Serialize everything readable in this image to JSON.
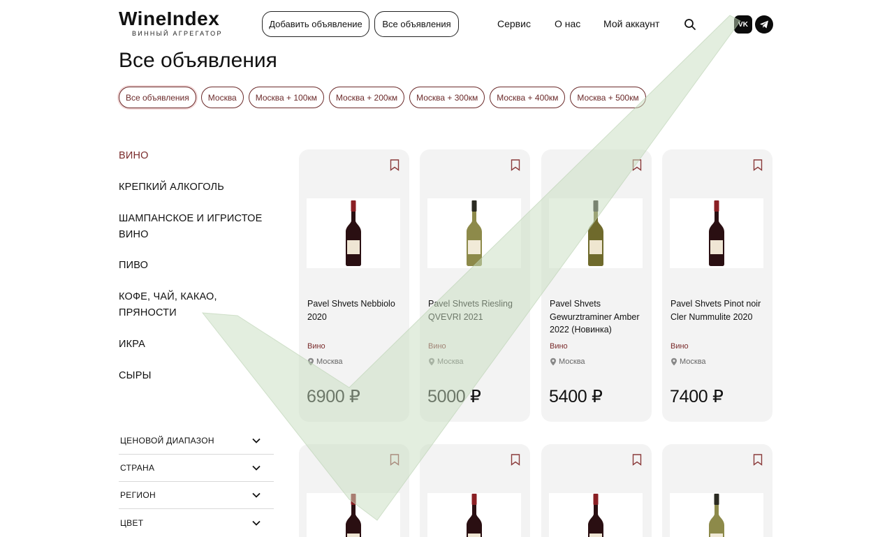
{
  "header": {
    "logo": "WineIndex",
    "logo_sub": "ВИННЫЙ АГРЕГАТОР",
    "add_button": "Добавить объявление",
    "all_button": "Все объявления",
    "nav": [
      "Сервис",
      "О нас",
      "Мой аккаунт"
    ],
    "social": [
      "VK",
      "Telegram"
    ]
  },
  "page_title": "Все объявления",
  "chips": [
    "Все объявления",
    "Москва",
    "Москва + 100км",
    "Москва + 200км",
    "Москва + 300км",
    "Москва + 400км",
    "Москва + 500км"
  ],
  "categories": [
    [
      "ВИНО"
    ],
    [
      "КРЕПКИЙ АЛКОГОЛЬ"
    ],
    [
      "ШАМПАНСКОЕ И ИГРИСТОЕ",
      "ВИНО"
    ],
    [
      "ПИВО"
    ],
    [
      "КОФЕ, ЧАЙ, КАКАО,",
      "ПРЯНОСТИ"
    ],
    [
      "ИКРА"
    ],
    [
      "СЫРЫ"
    ]
  ],
  "filters": [
    "ЦЕНОВОЙ ДИАПАЗОН",
    "СТРАНА",
    "РЕГИОН",
    "ЦВЕТ"
  ],
  "products": [
    {
      "name_lines": [
        "Pavel Shvets Nebbiolo",
        "2020"
      ],
      "category": "Вино",
      "location": "Москва",
      "price": "6900 ₽",
      "wine": "red"
    },
    {
      "name_lines": [
        "Pavel Shvets Riesling",
        "QVEVRI 2021"
      ],
      "category": "Вино",
      "location": "Москва",
      "price": "5000 ₽",
      "wine": "white"
    },
    {
      "name_lines": [
        "Pavel Shvets",
        "Gewurztraminer Amber",
        "2022 (Новинка)"
      ],
      "category": "Вино",
      "location": "Москва",
      "price": "5400 ₽",
      "wine": "amber"
    },
    {
      "name_lines": [
        "Pavel Shvets Pinot noir",
        "Cler Nummulite 2020"
      ],
      "category": "Вино",
      "location": "Москва",
      "price": "7400 ₽",
      "wine": "red"
    }
  ],
  "second_row_wines": [
    "red",
    "red",
    "red",
    "white"
  ],
  "colors": {
    "accent": "#7a2b2b",
    "card_bg": "#f3f3f3",
    "check_overlay": "#c8ddc0"
  }
}
